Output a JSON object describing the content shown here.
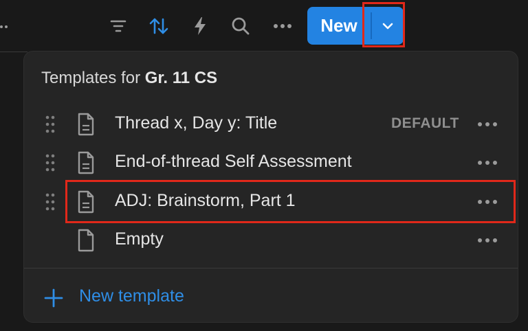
{
  "toolbar": {
    "icons": [
      "filter-icon",
      "sort-icon",
      "automation-icon",
      "search-icon",
      "more-icon"
    ],
    "new_label": "New",
    "accent": "#2383e2"
  },
  "templates_popup": {
    "title_prefix": "Templates for",
    "title_db": "Gr. 11 CS",
    "items": [
      {
        "label": "Thread x, Day y: Title",
        "badge": "DEFAULT"
      },
      {
        "label": "End-of-thread Self Assessment"
      },
      {
        "label": "ADJ: Brainstorm, Part 1"
      },
      {
        "label": "Empty"
      }
    ],
    "new_template_label": "New template"
  },
  "highlight_color": "#e1281a"
}
